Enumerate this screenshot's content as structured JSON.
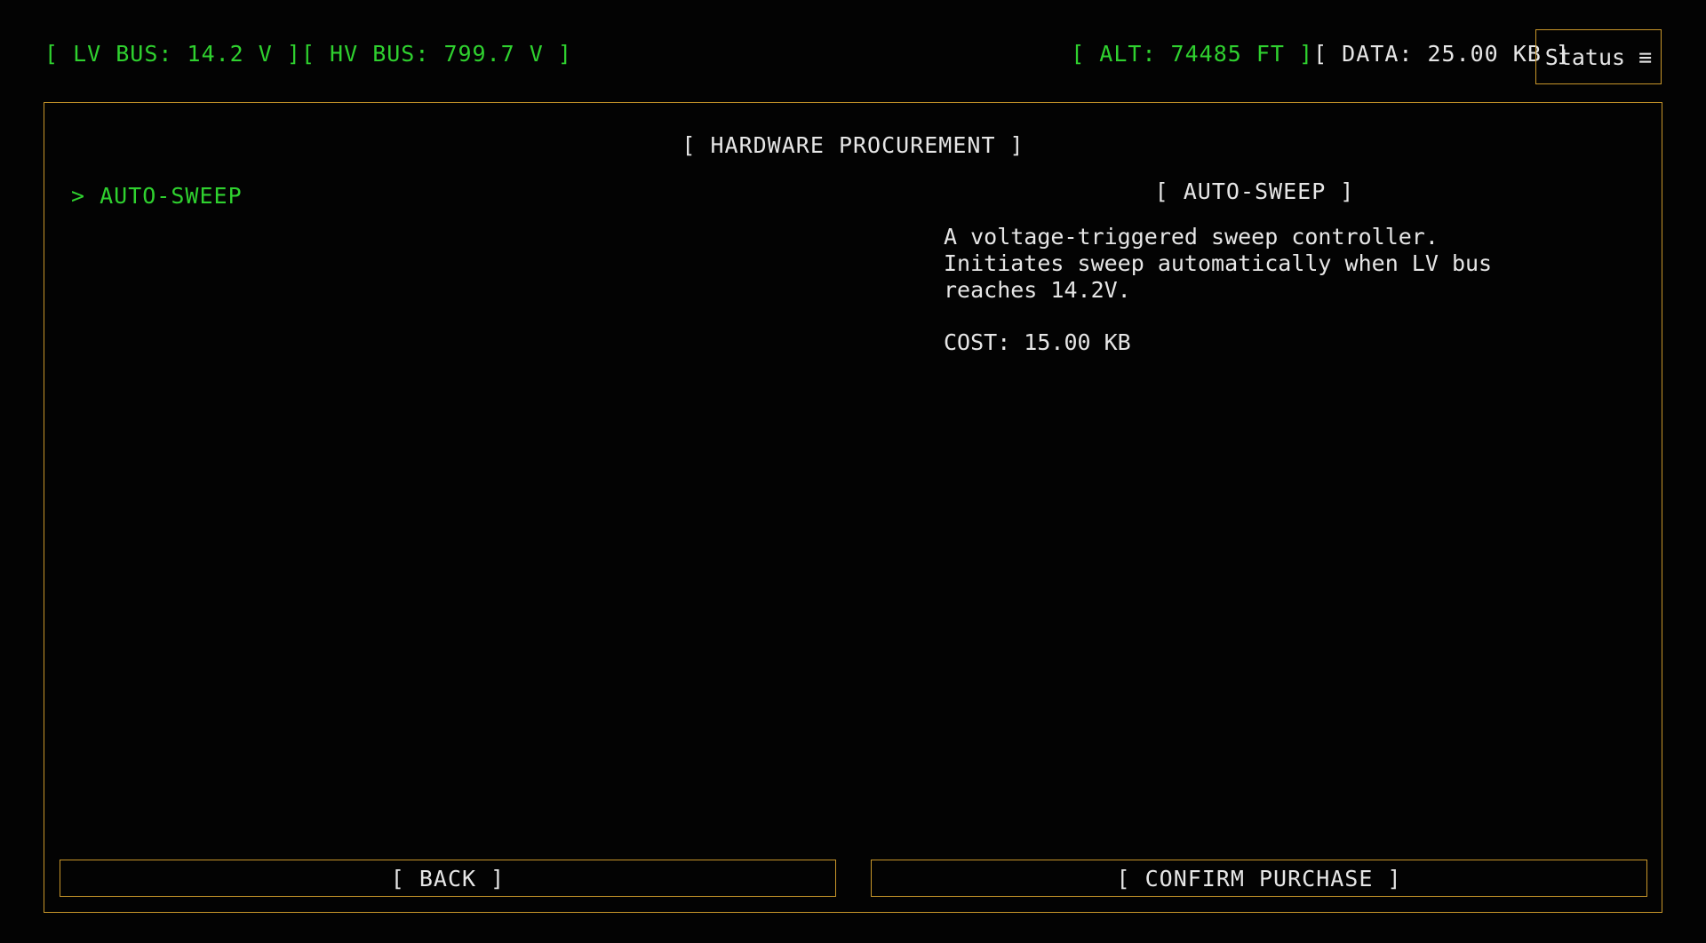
{
  "topbar": {
    "lv_bus": "[ LV BUS: 14.2 V ]",
    "hv_bus": "[ HV BUS: 799.7 V ]",
    "alt": "[ ALT: 74485 FT ]",
    "data": "[ DATA: 25.00 KB ]",
    "status_label": "Status ≡"
  },
  "panel": {
    "title": "[ HARDWARE PROCUREMENT ]",
    "items": [
      {
        "label": "> AUTO-SWEEP"
      }
    ],
    "detail": {
      "title": "[ AUTO-SWEEP ]",
      "description": "A voltage-triggered sweep controller. Initiates sweep automatically when LV bus reaches 14.2V.",
      "cost": "COST: 15.00 KB"
    },
    "buttons": {
      "back": "[ BACK ]",
      "confirm": "[ CONFIRM PURCHASE ]"
    }
  },
  "colors": {
    "accent_green": "#2fd12f",
    "border_amber": "#c8962a",
    "text_white": "#e6e6e6",
    "background": "#030303"
  }
}
